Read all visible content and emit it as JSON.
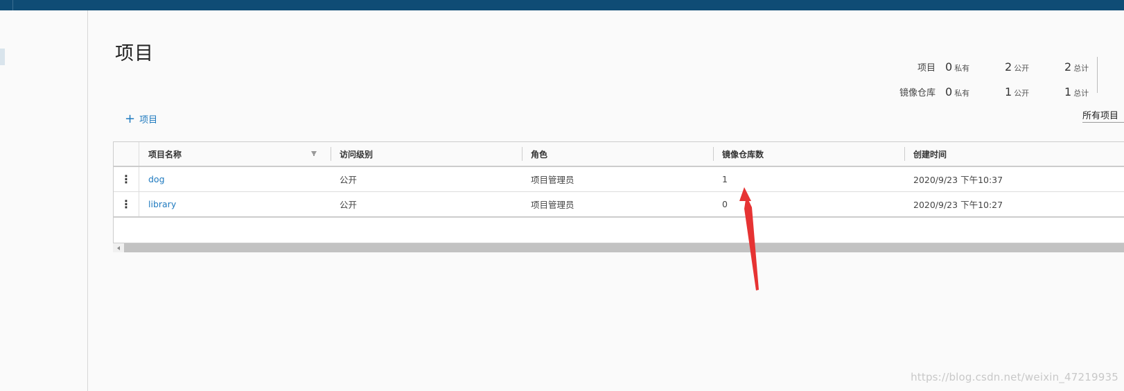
{
  "page": {
    "title": "项目"
  },
  "stats": {
    "rows": [
      {
        "label": "项目",
        "private_count": "0",
        "private_label": "私有",
        "public_count": "2",
        "public_label": "公开",
        "total_count": "2",
        "total_label": "总计"
      },
      {
        "label": "镜像仓库",
        "private_count": "0",
        "private_label": "私有",
        "public_count": "1",
        "public_label": "公开",
        "total_count": "1",
        "total_label": "总计"
      }
    ]
  },
  "actions": {
    "add_project_icon": "+",
    "add_project_label": "项目"
  },
  "filter": {
    "selected": "所有项目"
  },
  "table": {
    "columns": [
      "项目名称",
      "访问级别",
      "角色",
      "镜像仓库数",
      "创建时间"
    ],
    "rows": [
      {
        "name": "dog",
        "access": "公开",
        "role": "项目管理员",
        "repo_count": "1",
        "created": "2020/9/23 下午10:37"
      },
      {
        "name": "library",
        "access": "公开",
        "role": "项目管理员",
        "repo_count": "0",
        "created": "2020/9/23 下午10:27"
      }
    ]
  },
  "icons": {
    "row_actions": "more-vertical-icon",
    "filter": "filter-icon"
  },
  "colors": {
    "topbar": "#0f4c75",
    "link": "#1f7abf",
    "annotation": "#e63333"
  },
  "watermark": "https://blog.csdn.net/weixin_47219935"
}
